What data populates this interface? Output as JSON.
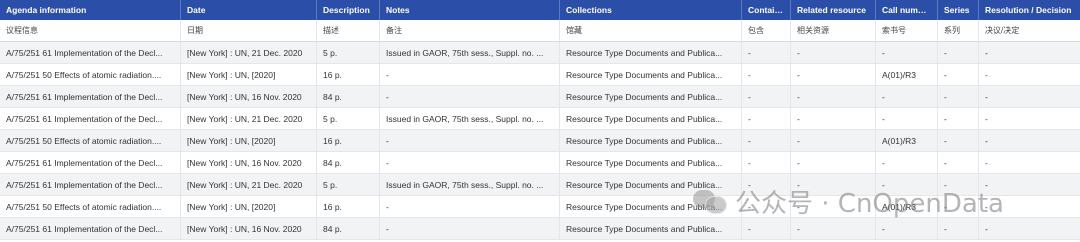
{
  "columns": [
    {
      "label": "Agenda information",
      "sublabel": "议程信息"
    },
    {
      "label": "Date",
      "sublabel": "日期"
    },
    {
      "label": "Description",
      "sublabel": "描述"
    },
    {
      "label": "Notes",
      "sublabel": "备注"
    },
    {
      "label": "Collections",
      "sublabel": "馆藏"
    },
    {
      "label": "Contains",
      "sublabel": "包含"
    },
    {
      "label": "Related resource",
      "sublabel": "相关资源"
    },
    {
      "label": "Call number",
      "sublabel": "索书号"
    },
    {
      "label": "Series",
      "sublabel": "系列"
    },
    {
      "label": "Resolution / Decision",
      "sublabel": "决议/决定"
    }
  ],
  "rows": [
    [
      "A/75/251 61 Implementation of the Decl...",
      "[New York] : UN, 21 Dec. 2020",
      "5 p.",
      "Issued in GAOR, 75th sess., Suppl. no. ...",
      "Resource Type Documents and Publica...",
      "-",
      "-",
      "-",
      "-",
      "-"
    ],
    [
      "A/75/251 50 Effects of atomic radiation....",
      "[New York] : UN, [2020]",
      "16 p.",
      "-",
      "Resource Type Documents and Publica...",
      "-",
      "-",
      "A(01)/R3",
      "-",
      "-"
    ],
    [
      "A/75/251 61 Implementation of the Decl...",
      "[New York] : UN, 16 Nov. 2020",
      "84 p.",
      "-",
      "Resource Type Documents and Publica...",
      "-",
      "-",
      "-",
      "-",
      "-"
    ],
    [
      "A/75/251 61 Implementation of the Decl...",
      "[New York] : UN, 21 Dec. 2020",
      "5 p.",
      "Issued in GAOR, 75th sess., Suppl. no. ...",
      "Resource Type Documents and Publica...",
      "-",
      "-",
      "-",
      "-",
      "-"
    ],
    [
      "A/75/251 50 Effects of atomic radiation....",
      "[New York] : UN, [2020]",
      "16 p.",
      "-",
      "Resource Type Documents and Publica...",
      "-",
      "-",
      "A(01)/R3",
      "-",
      "-"
    ],
    [
      "A/75/251 61 Implementation of the Decl...",
      "[New York] : UN, 16 Nov. 2020",
      "84 p.",
      "-",
      "Resource Type Documents and Publica...",
      "-",
      "-",
      "-",
      "-",
      "-"
    ],
    [
      "A/75/251 61 Implementation of the Decl...",
      "[New York] : UN, 21 Dec. 2020",
      "5 p.",
      "Issued in GAOR, 75th sess., Suppl. no. ...",
      "Resource Type Documents and Publica...",
      "-",
      "-",
      "-",
      "-",
      "-"
    ],
    [
      "A/75/251 50 Effects of atomic radiation....",
      "[New York] : UN, [2020]",
      "16 p.",
      "-",
      "Resource Type Documents and Publica...",
      "-",
      "-",
      "A(01)/R3",
      "-",
      "-"
    ],
    [
      "A/75/251 61 Implementation of the Decl...",
      "[New York] : UN, 16 Nov. 2020",
      "84 p.",
      "-",
      "Resource Type Documents and Publica...",
      "-",
      "-",
      "-",
      "-",
      "-"
    ]
  ],
  "watermark": {
    "text": "公众号 · CnOpenData",
    "icon": "wechat-icon"
  },
  "colors": {
    "header_bg": "#2b4ea8",
    "header_text": "#ffffff",
    "row_alt_bg": "#f2f3f5",
    "border": "#e3e6eb"
  }
}
